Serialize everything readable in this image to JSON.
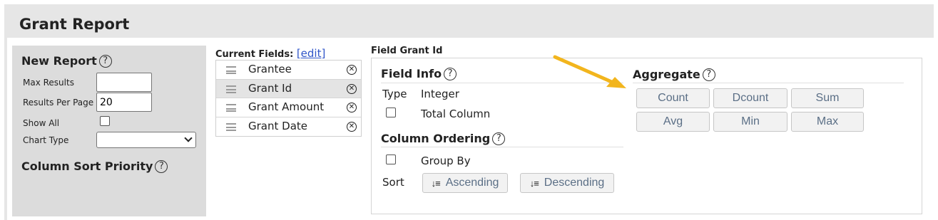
{
  "app": {
    "title": "Grant Report"
  },
  "left_panel": {
    "new_report_heading": "New Report",
    "help_glyph": "?",
    "max_results_label": "Max Results",
    "max_results_value": "",
    "results_per_page_label": "Results Per Page",
    "results_per_page_value": "20",
    "show_all_label": "Show All",
    "chart_type_label": "Chart Type",
    "chart_type_value": "",
    "sort_priority_heading": "Column Sort Priority"
  },
  "current_fields": {
    "title": "Current Fields:",
    "edit_link": "[edit]",
    "items": [
      {
        "label": "Grantee",
        "remove_glyph": "✕"
      },
      {
        "label": "Grant Id",
        "remove_glyph": "✕"
      },
      {
        "label": "Grant Amount",
        "remove_glyph": "✕"
      },
      {
        "label": "Grant Date",
        "remove_glyph": "✕"
      }
    ],
    "selected_index": 1
  },
  "field_panel": {
    "title": "Field Grant Id",
    "field_info": {
      "heading": "Field Info",
      "type_label": "Type",
      "type_value": "Integer",
      "total_column_label": "Total Column"
    },
    "column_ordering": {
      "heading": "Column Ordering",
      "group_by_label": "Group By",
      "sort_label": "Sort",
      "ascending_label": "Ascending",
      "descending_label": "Descending"
    },
    "aggregate": {
      "heading": "Aggregate",
      "buttons": [
        "Count",
        "Dcount",
        "Sum",
        "Avg",
        "Min",
        "Max"
      ]
    }
  },
  "colors": {
    "arrow": "#f2b51d",
    "link": "#2f55c8",
    "button_text": "#5b6f86"
  },
  "icons": {
    "help": "question-circle-icon",
    "drag": "drag-handle-icon",
    "remove": "remove-circle-icon",
    "sort_asc": "sort-ascending-icon",
    "sort_desc": "sort-descending-icon",
    "annotation": "arrow-annotation-icon"
  }
}
